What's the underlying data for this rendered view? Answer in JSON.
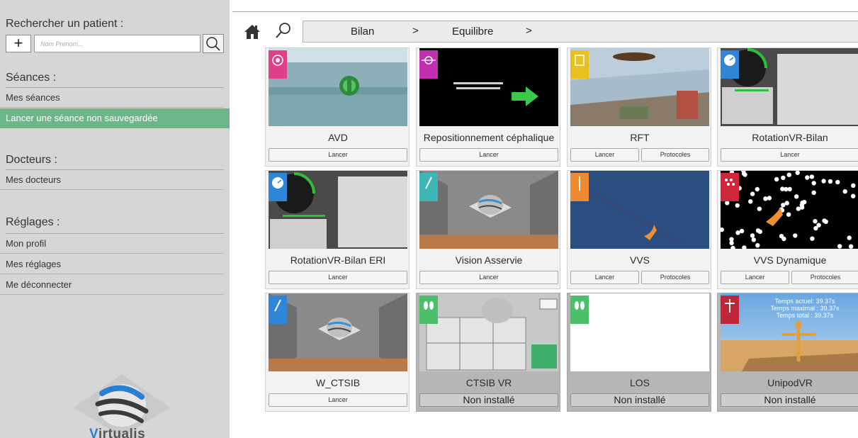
{
  "sidebar": {
    "search_title": "Rechercher un patient :",
    "add_label": "+",
    "search_placeholder": "Nom Prenom...",
    "sessions": {
      "title": "Séances :",
      "items": [
        {
          "label": "Mes séances"
        },
        {
          "label": "Lancer une séance non sauvegardée",
          "active": true
        }
      ]
    },
    "doctors": {
      "title": "Docteurs :",
      "items": [
        {
          "label": "Mes docteurs"
        }
      ]
    },
    "settings": {
      "title": "Réglages :",
      "items": [
        {
          "label": "Mon profil"
        },
        {
          "label": "Mes réglages"
        },
        {
          "label": "Me déconnecter"
        }
      ]
    },
    "logo_text_v": "V",
    "logo_text_rest": "irtualis"
  },
  "toolbar": {
    "home_icon": "home-icon",
    "search_icon": "magnifier-icon"
  },
  "breadcrumb": {
    "items": [
      "Bilan",
      "Equilibre"
    ],
    "separator": ">"
  },
  "colors": {
    "accent_green": "#6fb58a",
    "sidebar_bg": "#d6d6d6"
  },
  "cards": [
    {
      "title": "AVD",
      "buttons": [
        "Lancer"
      ],
      "badge_color": "#e0408a",
      "badge_icon": "target-icon"
    },
    {
      "title": "Repositionnement céphalique",
      "buttons": [
        "Lancer"
      ],
      "badge_color": "#c22fb0",
      "badge_icon": "crosshair-icon"
    },
    {
      "title": "RFT",
      "buttons": [
        "Lancer",
        "Protocoles"
      ],
      "badge_color": "#e8c020",
      "badge_icon": "frame-icon"
    },
    {
      "title": "RotationVR-Bilan",
      "buttons": [
        "Lancer"
      ],
      "badge_color": "#2f86d6",
      "badge_icon": "gauge-icon"
    },
    {
      "title": "RotationVR-Bilan ERI",
      "buttons": [
        "Lancer"
      ],
      "badge_color": "#2f86d6",
      "badge_icon": "gauge-icon"
    },
    {
      "title": "Vision Asservie",
      "buttons": [
        "Lancer"
      ],
      "badge_color": "#3fb6b6",
      "badge_icon": "pen-icon"
    },
    {
      "title": "VVS",
      "buttons": [
        "Lancer",
        "Protocoles"
      ],
      "badge_color": "#f08a30",
      "badge_icon": "line-icon"
    },
    {
      "title": "VVS Dynamique",
      "buttons": [
        "Lancer",
        "Protocoles"
      ],
      "badge_color": "#d0263a",
      "badge_icon": "dots-icon"
    },
    {
      "title": "W_CTSIB",
      "buttons": [
        "Lancer"
      ],
      "badge_color": "#2f86d6",
      "badge_icon": "pen-icon"
    },
    {
      "title": "CTSIB VR",
      "status": "Non installé",
      "badge_color": "#4cbf6a",
      "badge_icon": "feet-icon"
    },
    {
      "title": "LOS",
      "status": "Non installé",
      "badge_color": "#4cbf6a",
      "badge_icon": "feet-icon"
    },
    {
      "title": "UnipodVR",
      "status": "Non installé",
      "badge_color": "#c0263a",
      "badge_icon": "figure-icon",
      "overlay": [
        "Temps actuel: 39.37s",
        "Temps maximal : 39.37s",
        "Temps total : 39.37s"
      ]
    }
  ]
}
